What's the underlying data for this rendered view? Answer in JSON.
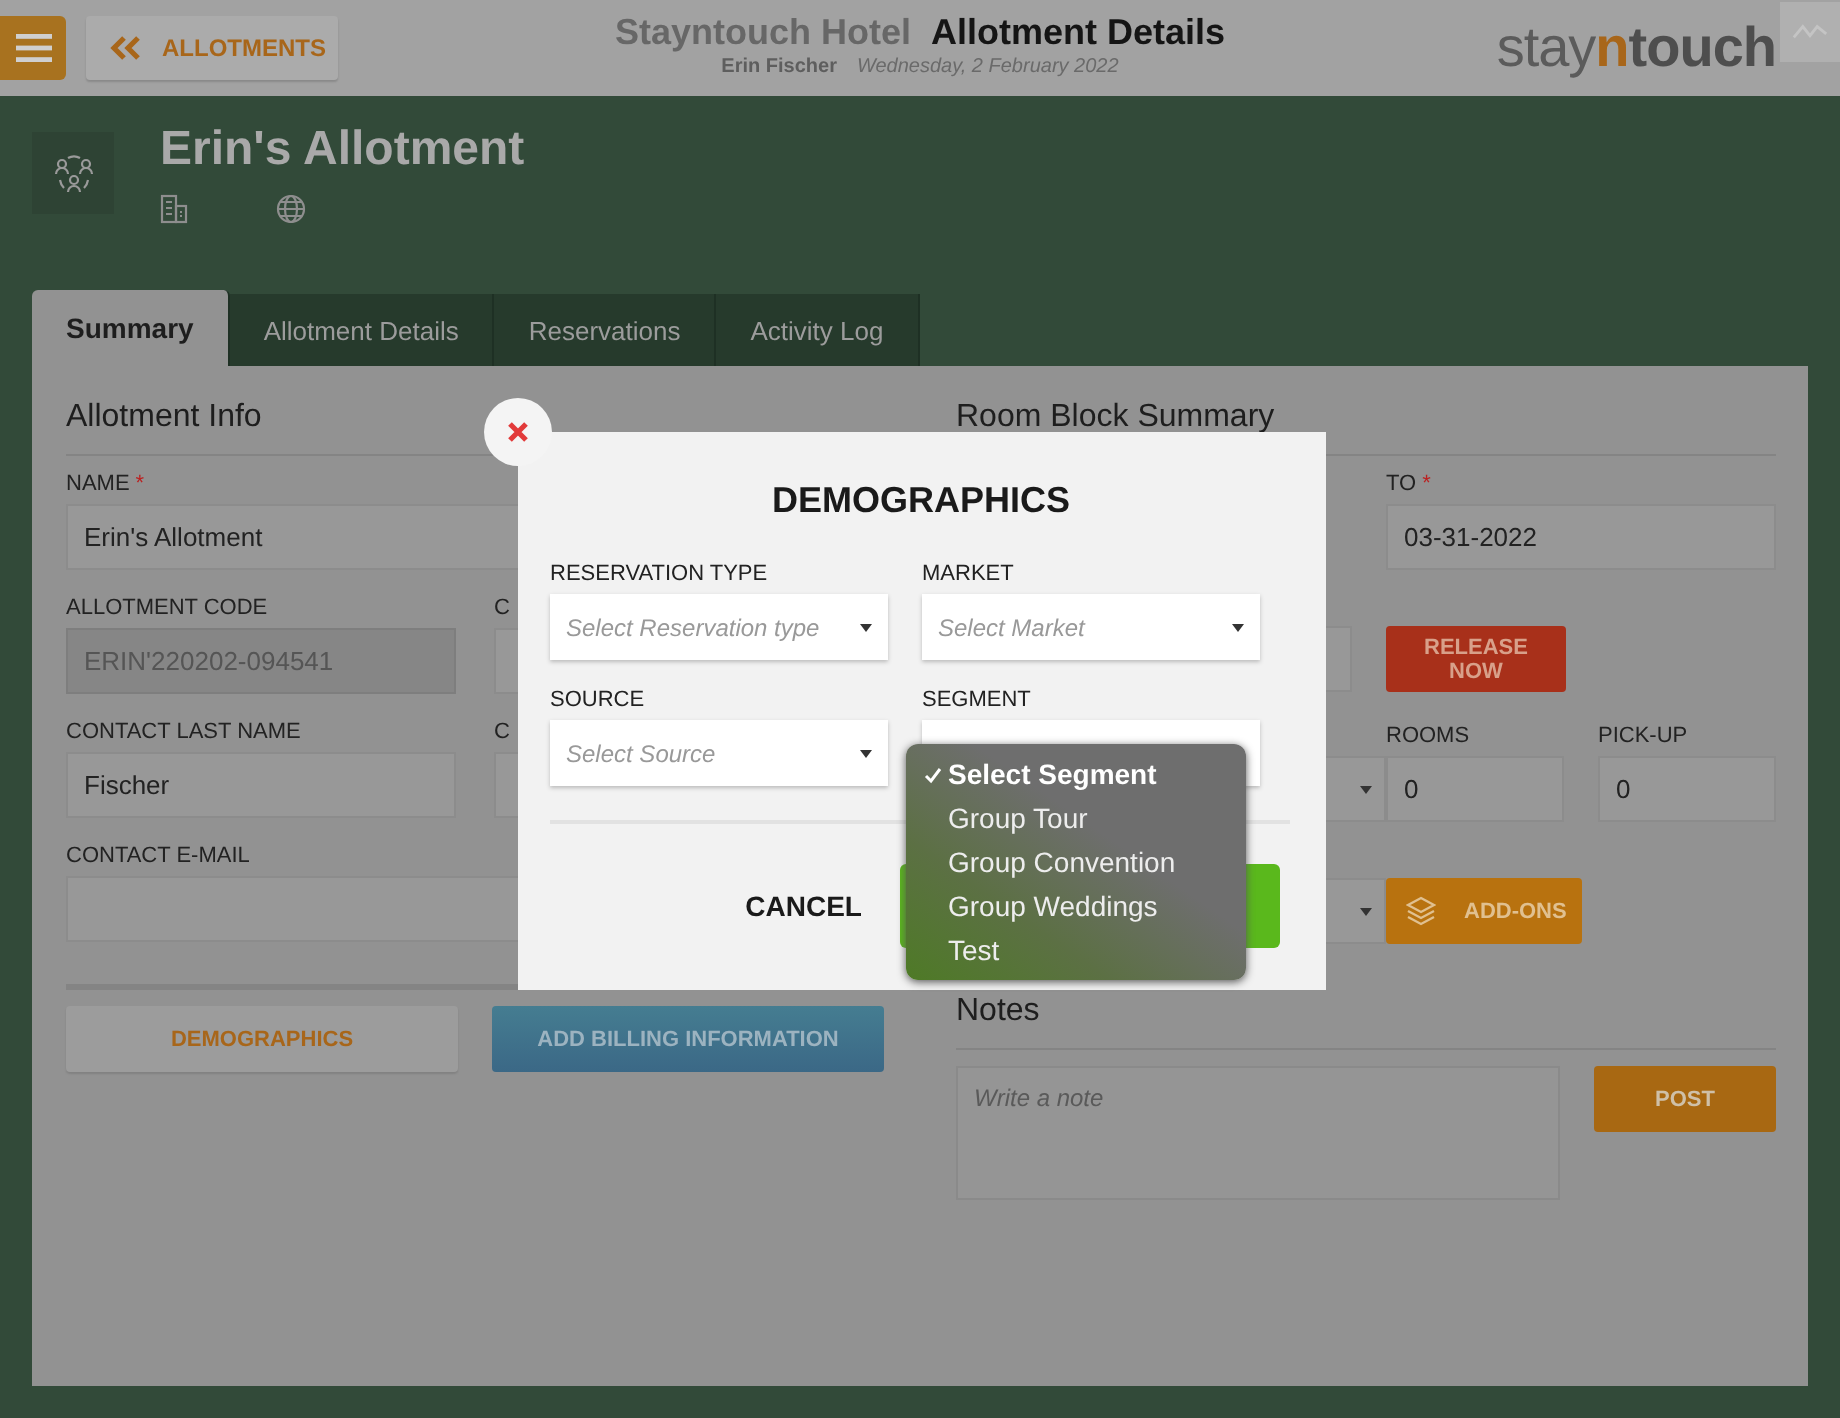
{
  "header": {
    "back_button": "ALLOTMENTS",
    "hotel": "Stayntouch Hotel",
    "page_title": "Allotment Details",
    "user": "Erin Fischer",
    "date": "Wednesday, 2 February 2022",
    "logo_parts": [
      {
        "text": "stay",
        "kind": "light"
      },
      {
        "text": "n",
        "kind": "accent"
      },
      {
        "text": "touch",
        "kind": "bold"
      }
    ]
  },
  "allotment": {
    "title": "Erin's Allotment"
  },
  "tabs": [
    {
      "label": "Summary",
      "selected": true
    },
    {
      "label": "Allotment Details",
      "selected": false
    },
    {
      "label": "Reservations",
      "selected": false
    },
    {
      "label": "Activity Log",
      "selected": false
    }
  ],
  "allotment_info": {
    "heading": "Allotment Info",
    "rows": [
      [
        {
          "label": "NAME",
          "required_mark": "*",
          "value": "Erin's Allotment",
          "readonly": false
        }
      ],
      [
        {
          "label": "ALLOTMENT CODE",
          "value": "ERIN'220202-094541",
          "readonly": true
        },
        {
          "label": "C"
        }
      ],
      [
        {
          "label": "CONTACT LAST NAME",
          "value": "Fischer",
          "readonly": false
        },
        {
          "label": "C"
        }
      ],
      [
        {
          "label": "CONTACT E-MAIL",
          "readonly": false
        }
      ]
    ],
    "buttons": [
      {
        "label": "DEMOGRAPHICS",
        "kind": "plain"
      },
      {
        "label": "ADD BILLING INFORMATION",
        "kind": "blue"
      }
    ]
  },
  "room_block": {
    "heading": "Room Block Summary",
    "to_field": {
      "label": "TO",
      "required_mark": "*",
      "value": "03-31-2022"
    },
    "release_button": "RELEASE NOW",
    "rooms": {
      "label": "ROOMS",
      "value": "0"
    },
    "pickup": {
      "label": "PICK-UP",
      "value": "0"
    },
    "addons_button": "ADD-ONS"
  },
  "notes": {
    "heading": "Notes",
    "placeholder": "Write a note",
    "post_button": "POST"
  },
  "modal": {
    "title": "DEMOGRAPHICS",
    "fields": [
      {
        "label": "RESERVATION TYPE",
        "placeholder": "Select Reservation type"
      },
      {
        "label": "MARKET",
        "placeholder": "Select Market"
      },
      {
        "label": "SOURCE",
        "placeholder": "Select Source"
      },
      {
        "label": "SEGMENT"
      }
    ],
    "cancel_button": "CANCEL",
    "segment_options": [
      {
        "label": "Select Segment",
        "selected": true
      },
      {
        "label": "Group Tour",
        "selected": false
      },
      {
        "label": "Group Convention",
        "selected": false
      },
      {
        "label": "Group Weddings",
        "selected": false
      },
      {
        "label": "Test",
        "selected": false
      }
    ]
  }
}
